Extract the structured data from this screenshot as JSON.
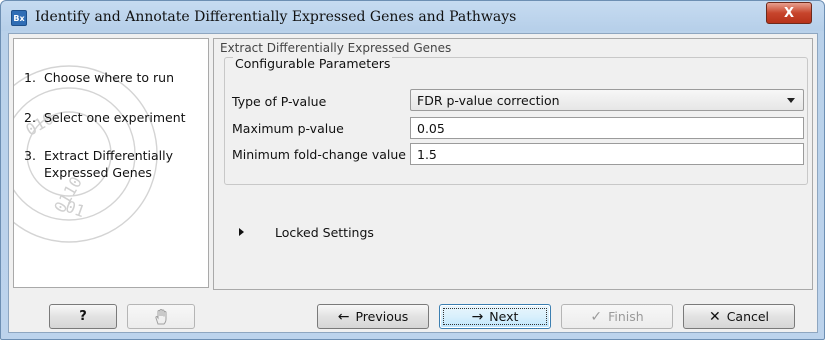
{
  "window": {
    "app_icon": "Bx",
    "title": "Identify and Annotate Differentially Expressed Genes and Pathways",
    "close_label": "X"
  },
  "steps": [
    {
      "num": "1.",
      "label": "Choose where to run"
    },
    {
      "num": "2.",
      "label": "Select one experiment"
    },
    {
      "num": "3.",
      "label": "Extract Differentially Expressed Genes"
    }
  ],
  "panel": {
    "header": "Extract Differentially Expressed Genes",
    "group_title": "Configurable Parameters",
    "pvalue_type": {
      "label": "Type of P-value",
      "value": "FDR p-value correction"
    },
    "max_pvalue": {
      "label": "Maximum p-value",
      "value": "0.05"
    },
    "min_fold_change": {
      "label": "Minimum fold-change value",
      "value": "1.5"
    },
    "locked_settings": "Locked Settings"
  },
  "footer": {
    "help": "?",
    "previous": "Previous",
    "next": "Next",
    "finish": "Finish",
    "cancel": "Cancel"
  },
  "icons": {
    "previous": "left-arrow-icon",
    "next": "right-arrow-icon",
    "finish": "checkmark-icon",
    "cancel": "x-icon",
    "reset": "hand-icon"
  }
}
